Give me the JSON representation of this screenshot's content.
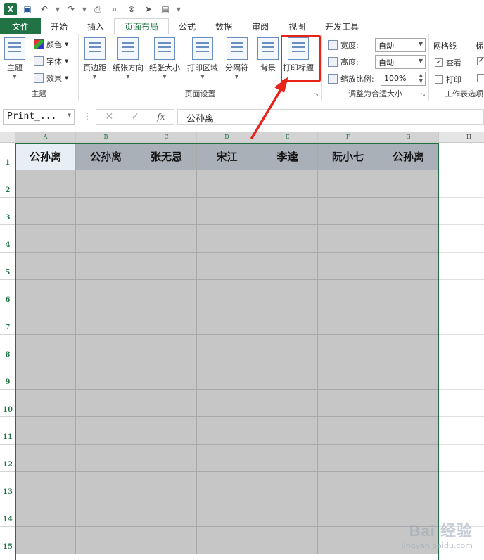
{
  "qat": {
    "icons": [
      "excel-logo",
      "save",
      "undo",
      "redo",
      "print-preview",
      "find",
      "close",
      "send",
      "view"
    ]
  },
  "tabs": [
    "文件",
    "开始",
    "插入",
    "页面布局",
    "公式",
    "数据",
    "审阅",
    "视图",
    "开发工具"
  ],
  "ribbon": {
    "theme_group": {
      "label": "主题",
      "theme_btn": "主题",
      "colors": "颜色",
      "fonts": "字体",
      "effects": "效果"
    },
    "page_setup_group": {
      "label": "页面设置",
      "margins": "页边距",
      "orientation": "纸张方向",
      "size": "纸张大小",
      "print_area": "打印区域",
      "breaks": "分隔符",
      "background": "背景",
      "print_titles": "打印标题"
    },
    "scale_group": {
      "label": "调整为合适大小",
      "width_label": "宽度:",
      "width_value": "自动",
      "height_label": "高度:",
      "height_value": "自动",
      "scale_label": "缩放比例:",
      "scale_value": "100%"
    },
    "sheet_options_group": {
      "label": "工作表选项",
      "gridlines": "网格线",
      "view": "查看",
      "print": "打印",
      "headings": "标"
    }
  },
  "formula_bar": {
    "name_box": "Print_...",
    "fx": "fx",
    "value": "公孙离"
  },
  "sheet": {
    "columns": [
      "A",
      "B",
      "C",
      "D",
      "E",
      "F",
      "G",
      "H"
    ],
    "rows": [
      "1",
      "2",
      "3",
      "4",
      "5",
      "6",
      "7",
      "8",
      "9",
      "10",
      "11",
      "12",
      "13",
      "14",
      "15"
    ],
    "header_row": [
      "公孙离",
      "公孙离",
      "张无忌",
      "宋江",
      "李逵",
      "阮小七",
      "公孙离"
    ]
  },
  "watermark": {
    "logo": "Bai 经验",
    "url": "jingyan.baidu.com"
  },
  "colors": {
    "excel_green": "#217346",
    "highlight_red": "#e8231a",
    "selection_gray": "#c6c6c6"
  }
}
